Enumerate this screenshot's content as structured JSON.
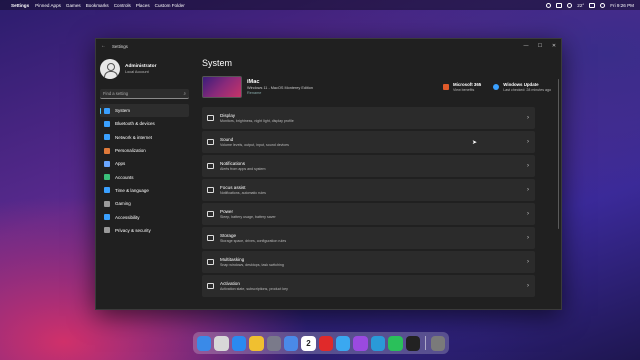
{
  "menubar": {
    "app": "Settings",
    "items": [
      "Pinned Apps",
      "Games",
      "Bookmarks",
      "Controls",
      "Places",
      "Custom Folder"
    ],
    "temp": "22°",
    "clock": "Fri 9:26 PM"
  },
  "window": {
    "title": "Settings",
    "back": "←",
    "min": "—",
    "max": "☐",
    "close": "✕"
  },
  "profile": {
    "name": "Administrator",
    "sub": "Local Account"
  },
  "search": {
    "placeholder": "Find a setting"
  },
  "nav": [
    {
      "label": "System",
      "color": "#3aa0ff"
    },
    {
      "label": "Bluetooth & devices",
      "color": "#3aa0ff"
    },
    {
      "label": "Network & internet",
      "color": "#3aa0ff"
    },
    {
      "label": "Personalization",
      "color": "#e07a3a"
    },
    {
      "label": "Apps",
      "color": "#6aa6ff"
    },
    {
      "label": "Accounts",
      "color": "#3ac07a"
    },
    {
      "label": "Time & language",
      "color": "#3aa0ff"
    },
    {
      "label": "Gaming",
      "color": "#9a9a9a"
    },
    {
      "label": "Accessibility",
      "color": "#3aa0ff"
    },
    {
      "label": "Privacy & security",
      "color": "#9a9a9a"
    }
  ],
  "main": {
    "title": "System",
    "device": {
      "name": "iMac",
      "os": "Windows 11 - MacOS Monterey Edition",
      "rename": "Rename"
    },
    "quick": [
      {
        "title": "Microsoft 365",
        "sub": "View benefits",
        "color": "#e05a2a"
      },
      {
        "title": "Windows Update",
        "sub": "Last checked: 28 minutes ago",
        "color": "#3aa0ff"
      }
    ],
    "rows": [
      {
        "title": "Display",
        "sub": "Monitors, brightness, night light, display profile"
      },
      {
        "title": "Sound",
        "sub": "Volume levels, output, input, sound devices"
      },
      {
        "title": "Notifications",
        "sub": "Alerts from apps and system"
      },
      {
        "title": "Focus assist",
        "sub": "Notifications, automatic rules"
      },
      {
        "title": "Power",
        "sub": "Sleep, battery usage, battery saver"
      },
      {
        "title": "Storage",
        "sub": "Storage space, drives, configuration rules"
      },
      {
        "title": "Multitasking",
        "sub": "Snap windows, desktops, task switching"
      },
      {
        "title": "Activation",
        "sub": "Activation state, subscriptions, product key"
      }
    ]
  },
  "dock": {
    "icons": [
      "finder",
      "launchpad",
      "app-store",
      "photos",
      "settings",
      "mail",
      "calendar",
      "youtube",
      "safari",
      "twitch",
      "edge",
      "spotify",
      "terminal",
      "trash"
    ],
    "colors": [
      "#3a8ae8",
      "#d8d8d8",
      "#2a8af0",
      "#f0c030",
      "#7a7a8a",
      "#4a8ae8",
      "#ffffff",
      "#e02a2a",
      "#3aa8f0",
      "#9a4ae0",
      "#2a9ad8",
      "#2ac05a",
      "#222222",
      "#7a7a7a"
    ],
    "calendar_day": "2"
  }
}
